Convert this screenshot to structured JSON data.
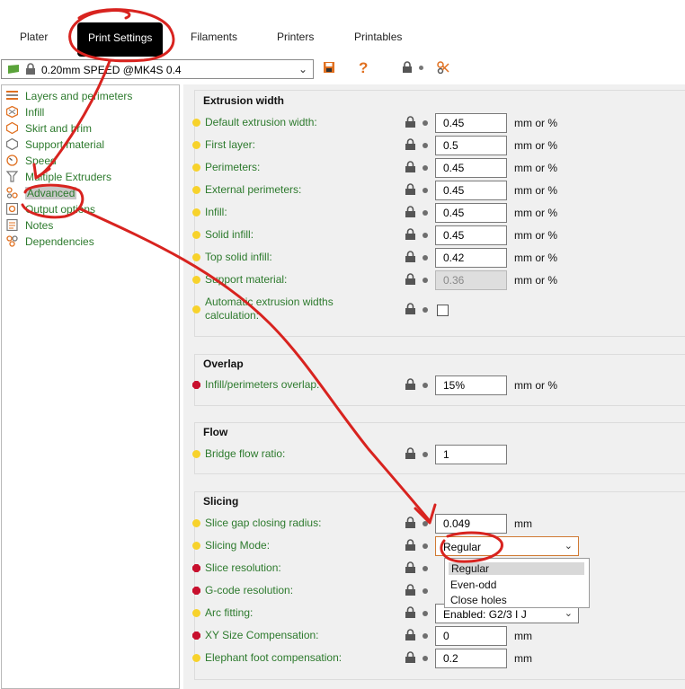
{
  "tabs": [
    {
      "label": "Plater"
    },
    {
      "label": "Print Settings",
      "active": true
    },
    {
      "label": "Filaments"
    },
    {
      "label": "Printers"
    },
    {
      "label": "Printables"
    }
  ],
  "preset": {
    "name": "0.20mm SPEED @MK4S 0.4"
  },
  "sidebar": {
    "items": [
      {
        "label": "Layers and perimeters",
        "icon": "layers-icon"
      },
      {
        "label": "Infill",
        "icon": "infill-icon"
      },
      {
        "label": "Skirt and brim",
        "icon": "skirt-icon"
      },
      {
        "label": "Support material",
        "icon": "support-icon"
      },
      {
        "label": "Speed",
        "icon": "speed-icon"
      },
      {
        "label": "Multiple Extruders",
        "icon": "extruders-icon"
      },
      {
        "label": "Advanced",
        "icon": "advanced-icon",
        "selected": true
      },
      {
        "label": "Output options",
        "icon": "output-icon"
      },
      {
        "label": "Notes",
        "icon": "notes-icon"
      },
      {
        "label": "Dependencies",
        "icon": "dependencies-icon"
      }
    ]
  },
  "groups": {
    "extrusion_width": {
      "title": "Extrusion width",
      "rows": [
        {
          "label": "Default extrusion width:",
          "value": "0.45",
          "unit": "mm or %"
        },
        {
          "label": "First layer:",
          "value": "0.5",
          "unit": "mm or %"
        },
        {
          "label": "Perimeters:",
          "value": "0.45",
          "unit": "mm or %"
        },
        {
          "label": "External perimeters:",
          "value": "0.45",
          "unit": "mm or %"
        },
        {
          "label": "Infill:",
          "value": "0.45",
          "unit": "mm or %"
        },
        {
          "label": "Solid infill:",
          "value": "0.45",
          "unit": "mm or %"
        },
        {
          "label": "Top solid infill:",
          "value": "0.42",
          "unit": "mm or %"
        },
        {
          "label": "Support material:",
          "value": "0.36",
          "unit": "mm or %"
        }
      ],
      "auto_label_line1": "Automatic extrusion widths",
      "auto_label_line2": "calculation:"
    },
    "overlap": {
      "title": "Overlap",
      "label": "Infill/perimeters overlap:",
      "value": "15%",
      "unit": "mm or %"
    },
    "flow": {
      "title": "Flow",
      "label": "Bridge flow ratio:",
      "value": "1"
    },
    "slicing": {
      "title": "Slicing",
      "gap": {
        "label": "Slice gap closing radius:",
        "value": "0.049",
        "unit": "mm"
      },
      "mode": {
        "label": "Slicing Mode:",
        "value": "Regular"
      },
      "resolution": {
        "label": "Slice resolution:"
      },
      "gcode_resolution": {
        "label": "G-code resolution:"
      },
      "arc": {
        "label": "Arc fitting:",
        "value": "Enabled: G2/3 I J"
      },
      "xy": {
        "label": "XY Size Compensation:",
        "value": "0",
        "unit": "mm"
      },
      "elephant": {
        "label": "Elephant foot compensation:",
        "value": "0.2",
        "unit": "mm"
      },
      "mode_options": [
        "Regular",
        "Even-odd",
        "Close holes"
      ]
    }
  },
  "colors": {
    "label_green": "#2d7a2d",
    "annotation_red": "#d8231f",
    "mode_yellow": "#f7d22b",
    "mode_red": "#c8102e"
  }
}
